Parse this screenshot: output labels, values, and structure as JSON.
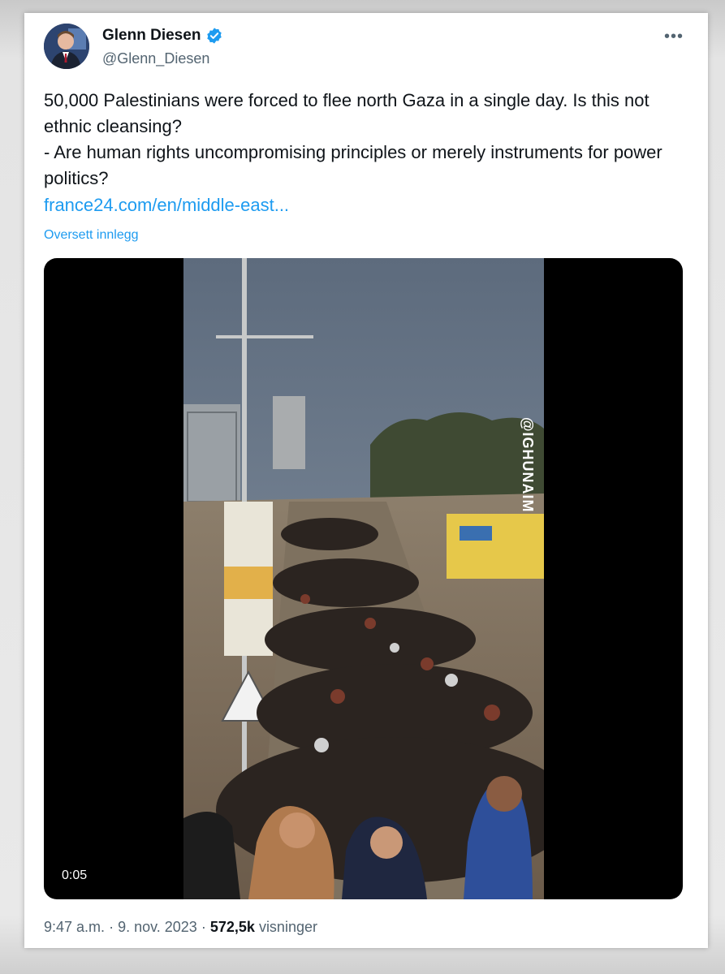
{
  "author": {
    "name": "Glenn Diesen",
    "handle": "@Glenn_Diesen",
    "verified_color": "#1d9bf0"
  },
  "post": {
    "line1": "50,000 Palestinians were forced to flee north Gaza in a single day. Is this not ethnic cleansing?",
    "line2": "- Are human rights uncompromising principles or merely instruments for power politics?",
    "link": "france24.com/en/middle-east...",
    "translate": "Oversett innlegg"
  },
  "video": {
    "duration": "0:05",
    "watermark": "@IGHUNAIM"
  },
  "meta": {
    "time": "9:47 a.m.",
    "separator": "·",
    "date": "9. nov. 2023",
    "views_count": "572,5k",
    "views_label": "visninger"
  },
  "icons": {
    "more": "more-options-icon",
    "verified": "verified-badge-icon"
  },
  "colors": {
    "link": "#1d9bf0",
    "text": "#0f1419",
    "secondary": "#536471"
  }
}
